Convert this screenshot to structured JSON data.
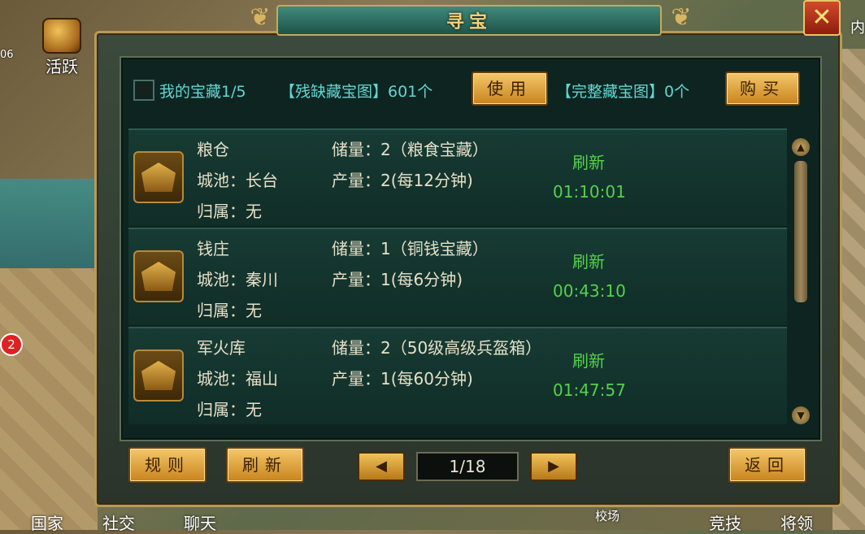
{
  "dialog": {
    "title": "寻宝",
    "close_icon": "✕"
  },
  "info": {
    "my_treasure": "我的宝藏1/5",
    "broken_map": "【残缺藏宝图】601个",
    "use_btn": "使用",
    "full_map": "【完整藏宝图】0个",
    "buy_btn": "购买"
  },
  "rows": [
    {
      "name": "粮仓",
      "city": "城池：长台",
      "owner": "归属：无",
      "stock": "储量：2（粮食宝藏）",
      "output": "产量：2(每12分钟)",
      "refresh": "刷新",
      "timer": "01:10:01"
    },
    {
      "name": "钱庄",
      "city": "城池：秦川",
      "owner": "归属：无",
      "stock": "储量：1（铜钱宝藏）",
      "output": "产量：1(每6分钟)",
      "refresh": "刷新",
      "timer": "00:43:10"
    },
    {
      "name": "军火库",
      "city": "城池：福山",
      "owner": "归属：无",
      "stock": "储量：2（50级高级兵盔箱）",
      "output": "产量：1(每60分钟)",
      "refresh": "刷新",
      "timer": "01:47:57"
    }
  ],
  "bottom": {
    "rules_btn": "规则",
    "refresh_btn": "刷新",
    "page": "1/18",
    "back_btn": "返回"
  },
  "hud": {
    "active_label": "活跃",
    "active_level": "06",
    "badge_count": "2",
    "tabs": [
      "国家",
      "社交",
      "聊天",
      "校场",
      "竞技",
      "将领"
    ],
    "right_label": "内"
  }
}
